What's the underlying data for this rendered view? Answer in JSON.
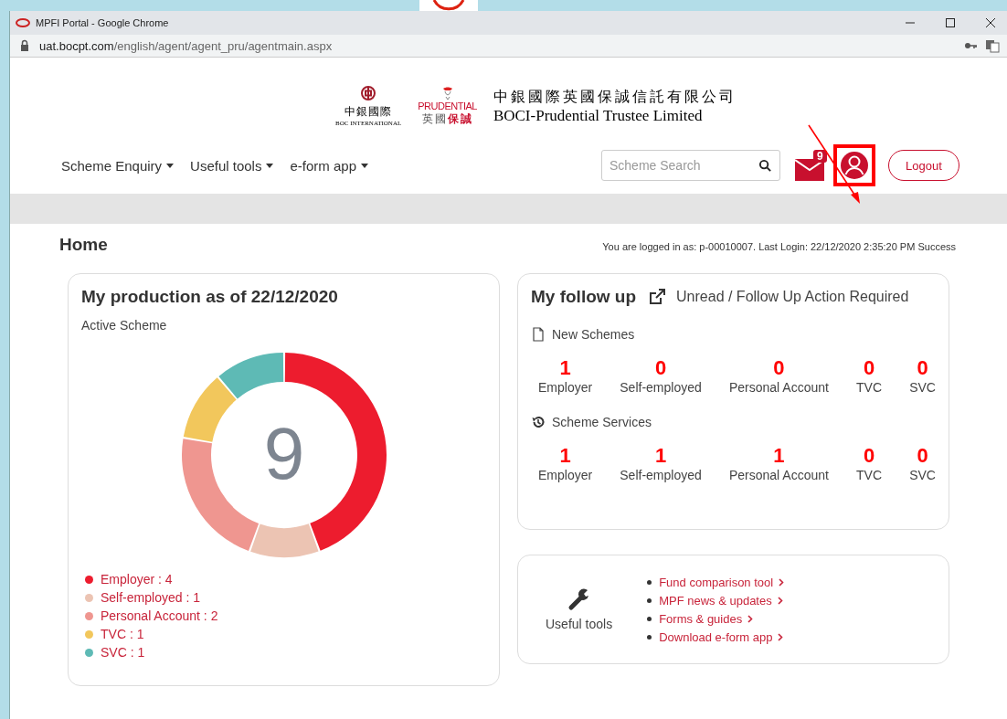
{
  "browser": {
    "title": "MPFI Portal - Google Chrome",
    "url_host": "uat.bocpt.com",
    "url_path": "/english/agent/agent_pru/agentmain.aspx"
  },
  "header": {
    "boc_cn": "中銀國際",
    "boc_en": "BOC INTERNATIONAL",
    "pru_en": "PRUDENTIAL",
    "pru_cn_a": "英國",
    "pru_cn_b": "保誠",
    "company_cn": "中銀國際英國保誠信託有限公司",
    "company_en": "BOCI-Prudential Trustee Limited"
  },
  "nav": [
    {
      "label": "Scheme Enquiry"
    },
    {
      "label": "Useful tools"
    },
    {
      "label": "e-form app"
    }
  ],
  "search": {
    "placeholder": "Scheme Search"
  },
  "mail_badge": "9",
  "user_button": {
    "highlighted": true
  },
  "logout": "Logout",
  "markup": [
    {
      "kind": "arrow"
    }
  ],
  "page_title": "Home",
  "login_info": "You are logged in as: p-00010007. Last Login: 22/12/2020 2:35:20 PM Success",
  "production": {
    "title": "My production as of 22/12/2020",
    "total": "9",
    "chart_data": {
      "type": "donut",
      "title": "Active Scheme",
      "values": [
        44.4,
        11.1,
        22.2,
        11.1,
        11.2
      ]
    },
    "legend": [
      {
        "label": "Employer : 4",
        "color": "#ed1c2e"
      },
      {
        "label": "Self-employed : 1",
        "color": "#ecc4b3"
      },
      {
        "label": "Personal Account : 2",
        "color": "#ef9690"
      },
      {
        "label": "TVC : 1",
        "color": "#f2c75c"
      },
      {
        "label": "SVC : 1",
        "color": "#5ebab5"
      }
    ]
  },
  "follow_up": {
    "title": "My follow up",
    "subtitle": "Unread / Follow Up Action Required",
    "groups": [
      {
        "kind": "document",
        "title": "New Schemes",
        "items": [
          {
            "value": "1",
            "label": "Employer"
          },
          {
            "value": "0",
            "label": "Self-employed"
          },
          {
            "value": "0",
            "label": "Personal Account"
          },
          {
            "value": "0",
            "label": "TVC"
          },
          {
            "value": "0",
            "label": "SVC"
          }
        ]
      },
      {
        "kind": "history",
        "title": "Scheme Services",
        "items": [
          {
            "value": "1",
            "label": "Employer"
          },
          {
            "value": "1",
            "label": "Self-employed"
          },
          {
            "value": "1",
            "label": "Personal Account"
          },
          {
            "value": "0",
            "label": "TVC"
          },
          {
            "value": "0",
            "label": "SVC"
          }
        ]
      }
    ]
  },
  "tools": {
    "title": "Useful tools",
    "links": [
      "Fund comparison tool",
      "MPF news & updates",
      "Forms & guides",
      "Download e-form app"
    ]
  }
}
